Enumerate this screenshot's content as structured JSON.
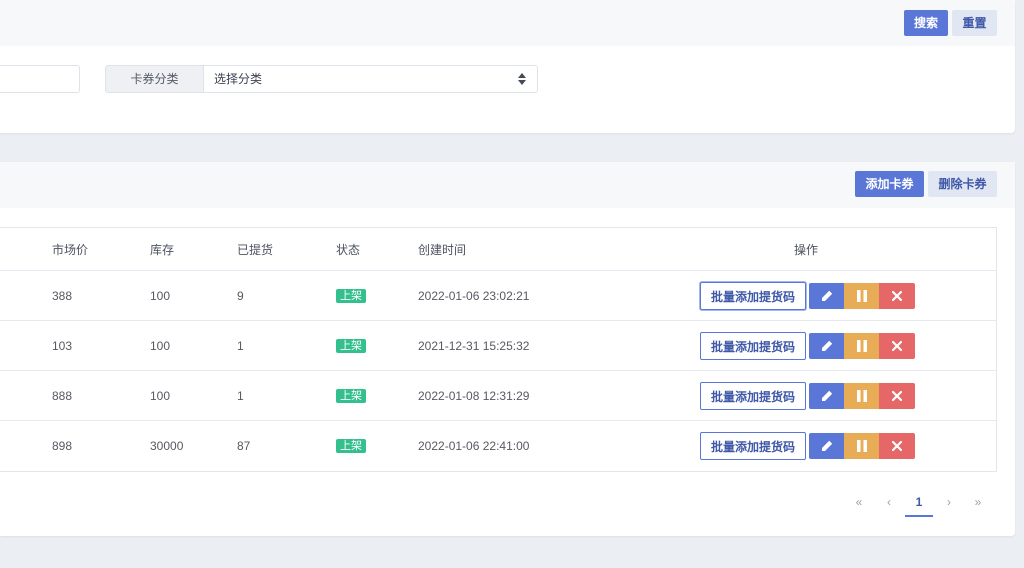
{
  "search": {
    "search_button": "搜索",
    "reset_button": "重置",
    "name_input_value": "",
    "category_label": "卡券分类",
    "category_selected": "选择分类"
  },
  "toolbar": {
    "add_button": "添加卡券",
    "delete_button": "删除卡券"
  },
  "table": {
    "columns": {
      "market_price": "市场价",
      "stock": "库存",
      "picked": "已提货",
      "status": "状态",
      "created_at": "创建时间",
      "actions": "操作"
    },
    "batch_add_label": "批量添加提货码",
    "rows": [
      {
        "market_price": "388",
        "stock": "100",
        "picked": "9",
        "status": "上架",
        "created_at": "2022-01-06 23:02:21"
      },
      {
        "market_price": "103",
        "stock": "100",
        "picked": "1",
        "status": "上架",
        "created_at": "2021-12-31 15:25:32"
      },
      {
        "market_price": "888",
        "stock": "100",
        "picked": "1",
        "status": "上架",
        "created_at": "2022-01-08 12:31:29"
      },
      {
        "market_price": "898",
        "stock": "30000",
        "picked": "87",
        "status": "上架",
        "created_at": "2022-01-06 22:41:00"
      }
    ]
  },
  "pagination": {
    "first": "«",
    "prev": "‹",
    "current": "1",
    "next": "›",
    "last": "»"
  },
  "icons": {
    "edit": "pencil-icon",
    "toggle": "pause-icon",
    "delete": "close-icon",
    "select": "sort-arrows-icon"
  },
  "colors": {
    "primary": "#5a77d7",
    "warning": "#e7ac55",
    "danger": "#e66767",
    "success": "#34bf8e"
  }
}
